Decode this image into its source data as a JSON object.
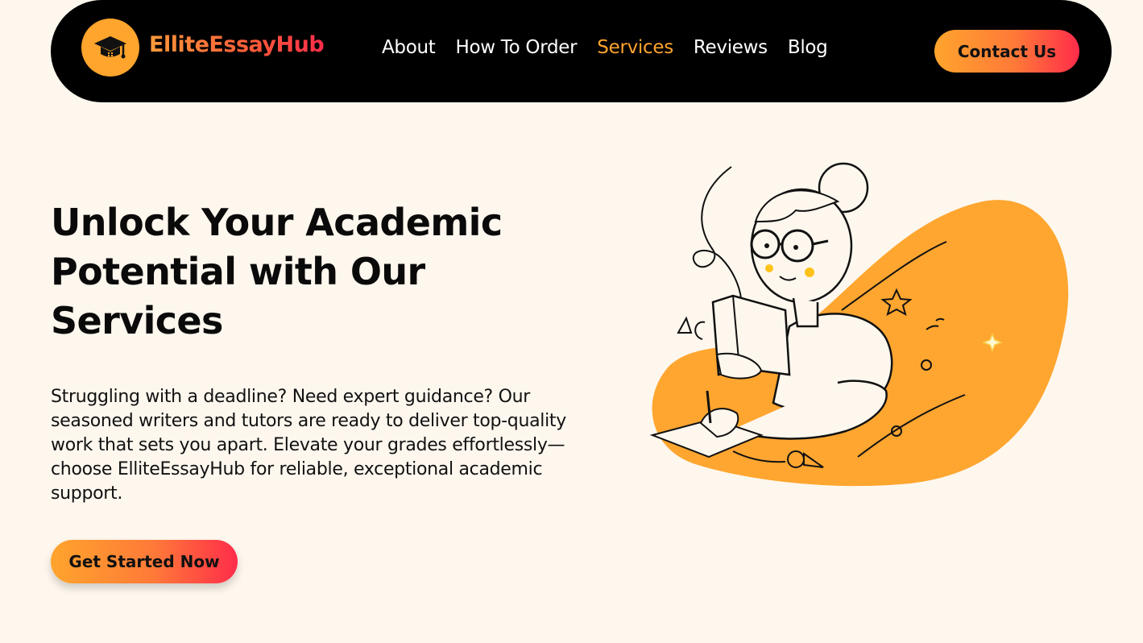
{
  "header": {
    "brand_name": "ElliteEssayHub",
    "logo_icon": "graduation-cap-icon",
    "nav": [
      {
        "label": "About",
        "active": false
      },
      {
        "label": "How To Order",
        "active": false
      },
      {
        "label": "Services",
        "active": true
      },
      {
        "label": "Reviews",
        "active": false
      },
      {
        "label": "Blog",
        "active": false
      }
    ],
    "contact_label": "Contact Us"
  },
  "hero": {
    "title": "Unlock Your Academic Potential with Our Services",
    "description": "Struggling with a deadline? Need expert guidance? Our seasoned writers and tutors are ready to deliver top-quality work that sets you apart. Elevate your grades effortlessly—choose ElliteEssayHub for reliable, exceptional academic support.",
    "cta_label": "Get Started Now",
    "illustration": "student-reading-illustration"
  },
  "colors": {
    "accent": "#ffa42d",
    "gradient_end": "#ff2c4a",
    "background": "#fdf7ee",
    "nav_background": "#000000"
  }
}
